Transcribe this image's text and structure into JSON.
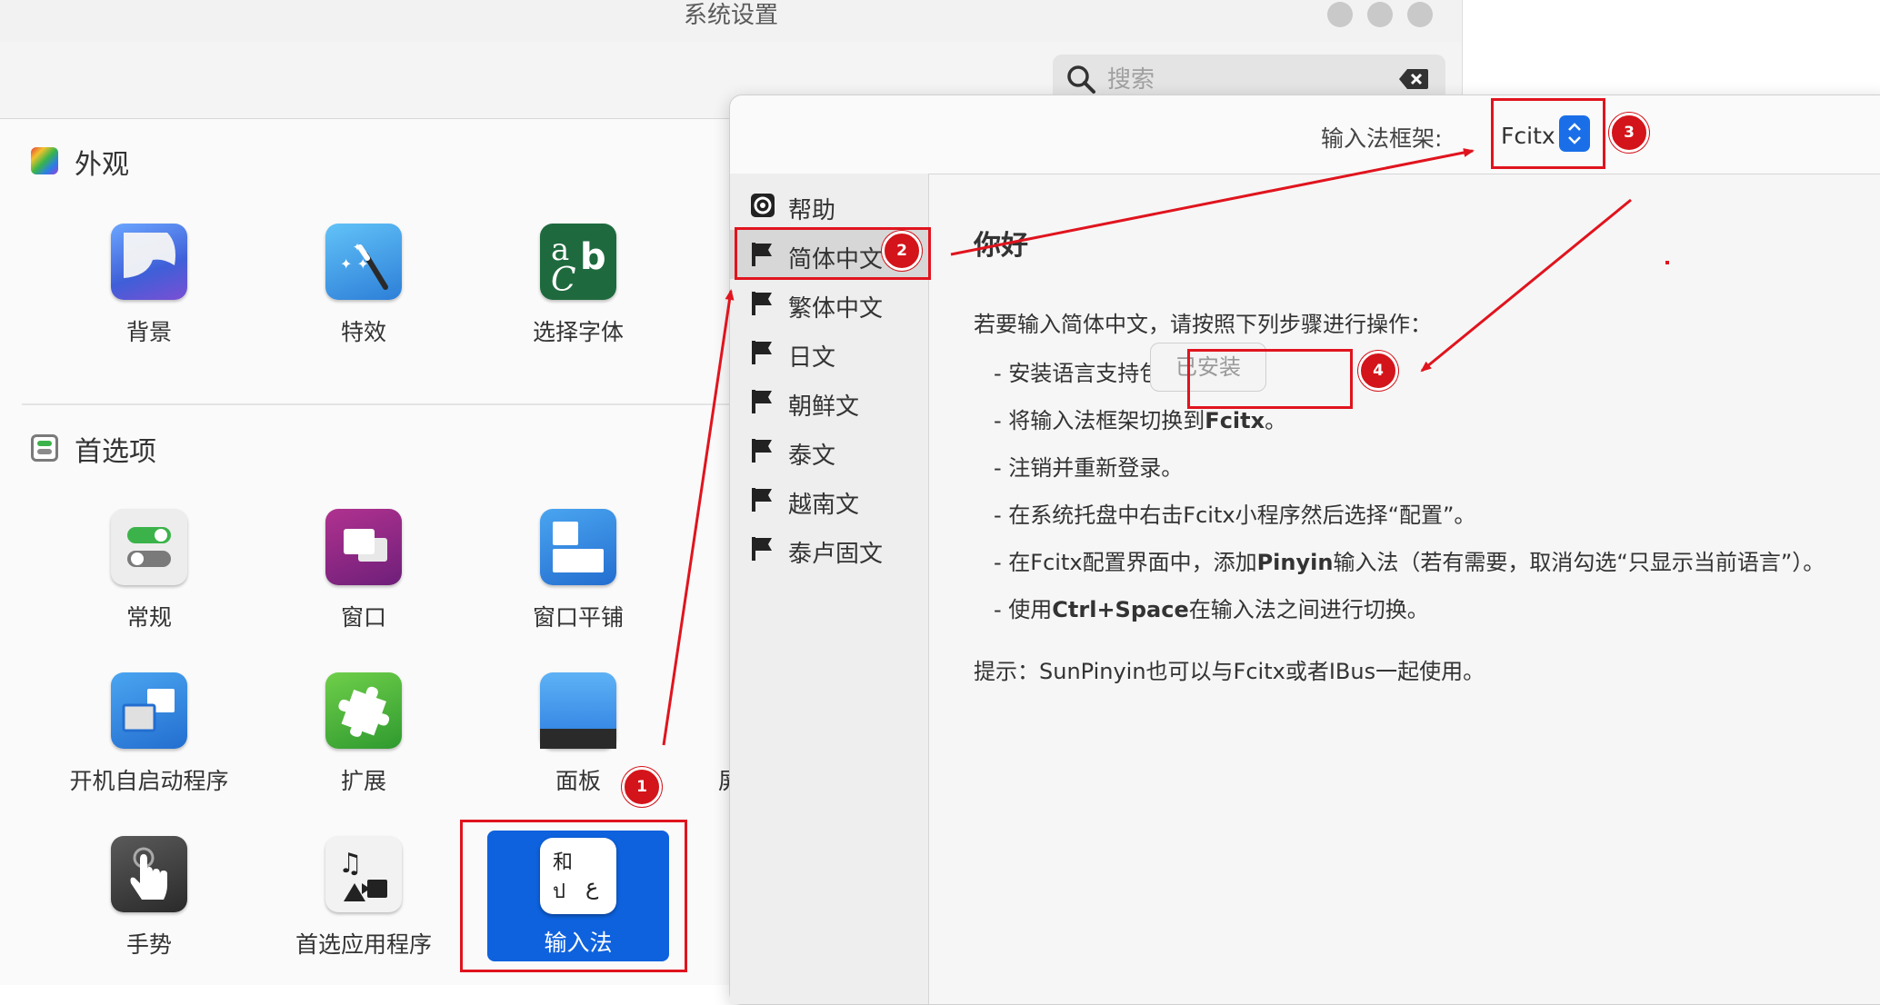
{
  "window": {
    "title": "系统设置",
    "search_placeholder": "搜索"
  },
  "sections": [
    {
      "title": "外观",
      "items": [
        {
          "label": "背景",
          "icon": "wallpaper-icon"
        },
        {
          "label": "特效",
          "icon": "effects-wand-icon"
        },
        {
          "label": "选择字体",
          "icon": "font-icon"
        }
      ]
    },
    {
      "title": "首选项",
      "items": [
        {
          "label": "常规",
          "icon": "toggles-icon"
        },
        {
          "label": "窗口",
          "icon": "windows-icon"
        },
        {
          "label": "窗口平铺",
          "icon": "window-tiling-icon"
        },
        {
          "label": "开机自启动程序",
          "icon": "startup-apps-icon"
        },
        {
          "label": "扩展",
          "icon": "puzzle-piece-icon"
        },
        {
          "label": "面板",
          "icon": "panel-icon"
        },
        {
          "label": "手势",
          "icon": "touch-gesture-icon"
        },
        {
          "label": "首选应用程序",
          "icon": "preferred-apps-icon"
        },
        {
          "label": "输入法",
          "icon": "input-method-icon",
          "selected": true
        }
      ]
    }
  ],
  "partial_label": "屏",
  "dialog": {
    "framework_label": "输入法框架:",
    "framework_value": "Fcitx",
    "sidebar": [
      {
        "label": "帮助",
        "icon": "help-lifebuoy-icon"
      },
      {
        "label": "简体中文",
        "icon": "flag-icon",
        "selected": true
      },
      {
        "label": "繁体中文",
        "icon": "flag-icon"
      },
      {
        "label": "日文",
        "icon": "flag-icon"
      },
      {
        "label": "朝鲜文",
        "icon": "flag-icon"
      },
      {
        "label": "泰文",
        "icon": "flag-icon"
      },
      {
        "label": "越南文",
        "icon": "flag-icon"
      },
      {
        "label": "泰卢固文",
        "icon": "flag-icon"
      }
    ],
    "heading": "你好",
    "intro": "若要输入简体中文，请按照下列步骤进行操作：",
    "steps": {
      "s1": "- 安装语言支持包：",
      "s1_button": "已安装",
      "s2_pre": "- 将输入法框架切换到",
      "s2_bold": "Fcitx",
      "s2_post": "。",
      "s3": "- 注销并重新登录。",
      "s4": "- 在系统托盘中右击Fcitx小程序然后选择“配置”。",
      "s5_pre": "- 在Fcitx配置界面中，添加",
      "s5_bold": "Pinyin",
      "s5_post": "输入法（若有需要，取消勾选“只显示当前语言”）。",
      "s6_pre": "- 使用",
      "s6_bold": "Ctrl+Space",
      "s6_post": "在输入法之间进行切换。"
    },
    "tip": "提示：SunPinyin也可以与Fcitx或者IBus一起使用。"
  },
  "annotations": [
    "1",
    "2",
    "3",
    "4"
  ],
  "colors": {
    "accent_blue": "#0e62de",
    "annotation_red": "#e0141e"
  }
}
